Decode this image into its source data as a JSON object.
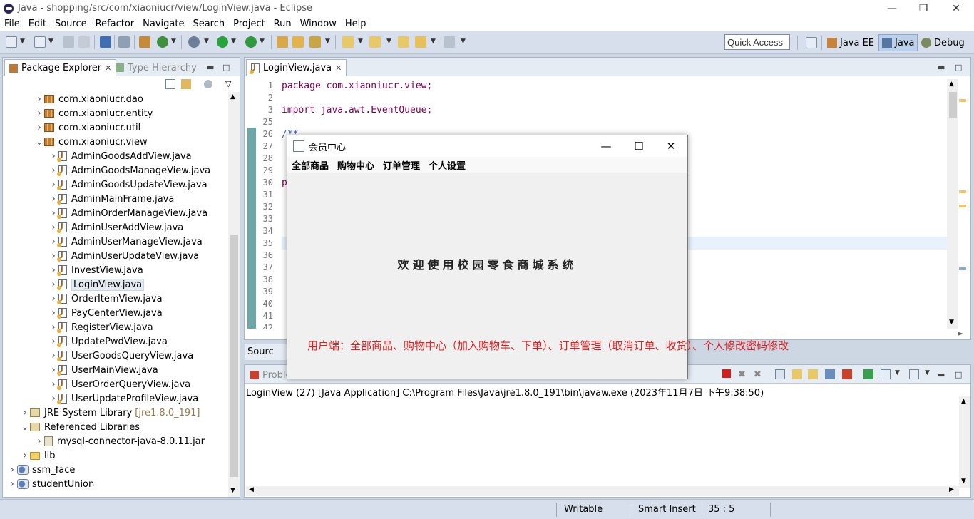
{
  "window": {
    "title": "Java - shopping/src/com/xiaoniucr/view/LoginView.java - Eclipse"
  },
  "menu": [
    "File",
    "Edit",
    "Source",
    "Refactor",
    "Navigate",
    "Search",
    "Project",
    "Run",
    "Window",
    "Help"
  ],
  "quick_access": "Quick Access",
  "perspectives": [
    {
      "label": "Java EE"
    },
    {
      "label": "Java",
      "active": true
    },
    {
      "label": "Debug"
    }
  ],
  "package_explorer": {
    "tabs": [
      "Package Explorer",
      "Type Hierarchy"
    ],
    "items": [
      {
        "label": "com.xiaoniucr.dao",
        "type": "package",
        "depth": 2,
        "expanded": false
      },
      {
        "label": "com.xiaoniucr.entity",
        "type": "package",
        "depth": 2,
        "expanded": false
      },
      {
        "label": "com.xiaoniucr.util",
        "type": "package",
        "depth": 2,
        "expanded": false
      },
      {
        "label": "com.xiaoniucr.view",
        "type": "package",
        "depth": 2,
        "expanded": true
      },
      {
        "label": "AdminGoodsAddView.java",
        "type": "java",
        "depth": 3
      },
      {
        "label": "AdminGoodsManageView.java",
        "type": "java",
        "depth": 3
      },
      {
        "label": "AdminGoodsUpdateView.java",
        "type": "java",
        "depth": 3
      },
      {
        "label": "AdminMainFrame.java",
        "type": "java",
        "depth": 3
      },
      {
        "label": "AdminOrderManageView.java",
        "type": "java",
        "depth": 3
      },
      {
        "label": "AdminUserAddView.java",
        "type": "java",
        "depth": 3
      },
      {
        "label": "AdminUserManageView.java",
        "type": "java",
        "depth": 3
      },
      {
        "label": "AdminUserUpdateView.java",
        "type": "java",
        "depth": 3
      },
      {
        "label": "InvestView.java",
        "type": "java",
        "depth": 3
      },
      {
        "label": "LoginView.java",
        "type": "java",
        "depth": 3,
        "selected": true
      },
      {
        "label": "OrderItemView.java",
        "type": "java",
        "depth": 3
      },
      {
        "label": "PayCenterView.java",
        "type": "java",
        "depth": 3
      },
      {
        "label": "RegisterView.java",
        "type": "java",
        "depth": 3
      },
      {
        "label": "UpdatePwdView.java",
        "type": "java",
        "depth": 3
      },
      {
        "label": "UserGoodsQueryView.java",
        "type": "java",
        "depth": 3
      },
      {
        "label": "UserMainView.java",
        "type": "java",
        "depth": 3
      },
      {
        "label": "UserOrderQueryView.java",
        "type": "java",
        "depth": 3
      },
      {
        "label": "UserUpdateProfileView.java",
        "type": "java",
        "depth": 3
      },
      {
        "label": "JRE System Library",
        "suffix": "[jre1.8.0_191]",
        "type": "lib",
        "depth": 1,
        "expanded": false
      },
      {
        "label": "Referenced Libraries",
        "type": "lib",
        "depth": 1,
        "expanded": true
      },
      {
        "label": "mysql-connector-java-8.0.11.jar",
        "type": "jar",
        "depth": 2
      },
      {
        "label": "lib",
        "type": "folder",
        "depth": 1,
        "expanded": false
      },
      {
        "label": "ssm_face",
        "type": "project",
        "depth": 0,
        "expanded": false
      },
      {
        "label": "studentUnion",
        "type": "project",
        "depth": 0,
        "expanded": false
      }
    ]
  },
  "editor": {
    "tab": "LoginView.java",
    "lines": [
      {
        "n": "1",
        "code": "package com.xiaoniucr.view;"
      },
      {
        "n": "2",
        "code": ""
      },
      {
        "n": "3",
        "code": "import java.awt.EventQueue;"
      },
      {
        "n": "25",
        "code": ""
      },
      {
        "n": "26",
        "code": "/**"
      },
      {
        "n": "27",
        "code": ""
      },
      {
        "n": "28",
        "code": ""
      },
      {
        "n": "29",
        "code": ""
      },
      {
        "n": "30",
        "code": "p"
      },
      {
        "n": "31",
        "code": ""
      },
      {
        "n": "32",
        "code": ""
      },
      {
        "n": "33",
        "code": ""
      },
      {
        "n": "34",
        "code": ""
      },
      {
        "n": "35",
        "code": ""
      },
      {
        "n": "36",
        "code": ""
      },
      {
        "n": "37",
        "code": ""
      },
      {
        "n": "38",
        "code": ""
      },
      {
        "n": "39",
        "code": ""
      },
      {
        "n": "40",
        "code": ""
      },
      {
        "n": "41",
        "code": ""
      },
      {
        "n": "42",
        "code": ""
      }
    ]
  },
  "source_tab": "Sourc",
  "console": {
    "tab": "Proble",
    "launch": "LoginView (27) [Java Application] C:\\Program Files\\Java\\jre1.8.0_191\\bin\\javaw.exe (2023年11月7日 下午9:38:50)"
  },
  "dialog": {
    "title": "会员中心",
    "menu": [
      "全部商品",
      "购物中心",
      "订单管理",
      "个人设置"
    ],
    "welcome": "欢迎使用校园零食商城系统"
  },
  "annotation": "用户端：全部商品、购物中心（加入购物车、下单）、订单管理（取消订单、收货）、个人修改密码修改",
  "status": {
    "writable": "Writable",
    "insert": "Smart Insert",
    "position": "35 : 5"
  }
}
